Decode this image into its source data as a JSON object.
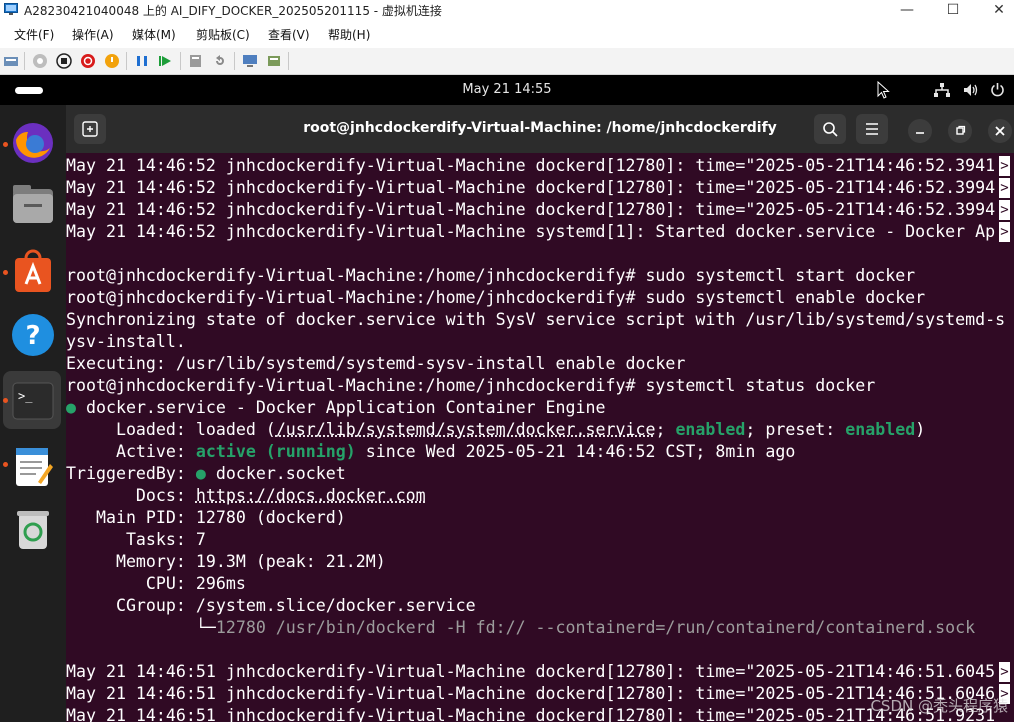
{
  "host_window": {
    "title": "A28230421040048 上的 AI_DIFY_DOCKER_202505201115 - 虚拟机连接",
    "minimize": "—",
    "maximize": "☐",
    "close": "✕"
  },
  "host_menu": [
    "文件(F)",
    "操作(A)",
    "媒体(M)",
    "剪贴板(C)",
    "查看(V)",
    "帮助(H)"
  ],
  "ubuntu_topbar": {
    "clock": "May 21  14:55"
  },
  "dock": [
    "firefox-icon",
    "files-icon",
    "app-center-icon",
    "help-icon",
    "terminal-icon",
    "text-editor-icon",
    "trash-icon"
  ],
  "terminal": {
    "title": "root@jnhcdockerdify-Virtual-Machine: /home/jnhcdockerdify",
    "lines": {
      "l1": "May 21 14:46:52 jnhcdockerdify-Virtual-Machine dockerd[12780]: time=\"2025-05-21T14:46:52.3941",
      "l2": "May 21 14:46:52 jnhcdockerdify-Virtual-Machine dockerd[12780]: time=\"2025-05-21T14:46:52.3994",
      "l3": "May 21 14:46:52 jnhcdockerdify-Virtual-Machine dockerd[12780]: time=\"2025-05-21T14:46:52.3994",
      "l4": "May 21 14:46:52 jnhcdockerdify-Virtual-Machine systemd[1]: Started docker.service - Docker Ap",
      "prompt": "root@jnhcdockerdify-Virtual-Machine:/home/jnhcdockerdify# ",
      "cmd1": "sudo systemctl start docker",
      "cmd2": "sudo systemctl enable docker",
      "sync1": "Synchronizing state of docker.service with SysV service script with /usr/lib/systemd/systemd-s",
      "sync2": "ysv-install.",
      "exec": "Executing: /usr/lib/systemd/systemd-sysv-install enable docker",
      "cmd3": "systemctl status docker",
      "svc": " docker.service - Docker Application Container Engine",
      "loaded_label": "     Loaded: ",
      "loaded_a": "loaded (",
      "loaded_path": "/usr/lib/systemd/system/docker.service",
      "loaded_b": "; ",
      "enabled": "enabled",
      "loaded_c": "; preset: ",
      "loaded_d": ")",
      "active_label": "     Active: ",
      "active_state": "active (running)",
      "active_since": " since Wed 2025-05-21 14:46:52 CST; 8min ago",
      "trig_label": "TriggeredBy: ",
      "trig_val": " docker.socket",
      "docs_label": "       Docs: ",
      "docs_val": "https://docs.docker.com",
      "pid": "   Main PID: 12780 (dockerd)",
      "tasks": "      Tasks: 7",
      "memory": "     Memory: 19.3M (peak: 21.2M)",
      "cpu": "        CPU: 296ms",
      "cgroup": "     CGroup: /system.slice/docker.service",
      "cg_indent": "             ",
      "cg_tree": "└─",
      "cg_proc": "12780 /usr/bin/dockerd -H fd:// --containerd=/run/containerd/containerd.sock",
      "l5": "May 21 14:46:51 jnhcdockerdify-Virtual-Machine dockerd[12780]: time=\"2025-05-21T14:46:51.6045",
      "l6": "May 21 14:46:51 jnhcdockerdify-Virtual-Machine dockerd[12780]: time=\"2025-05-21T14:46:51.6046",
      "l7": "May 21 14:46:51 jnhcdockerdify-Virtual-Machine dockerd[12780]: time=\"2025-05-21T14:46:51.9231"
    },
    "overflow_mark": ">"
  },
  "watermark": "CSDN @秃头程序猿",
  "colors": {
    "terminal_bg": "#300a24",
    "green": "#26a269",
    "dock_dot": "#e95420"
  }
}
